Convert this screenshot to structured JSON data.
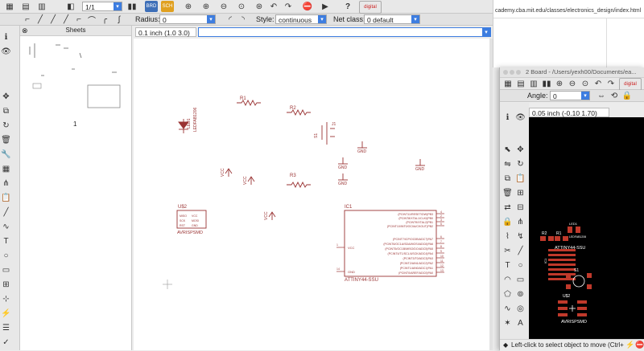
{
  "schematic": {
    "toolbar": {
      "sheet_selector": "1/1",
      "radius_label": "Radius:",
      "radius_value": "0",
      "style_label": "Style:",
      "style_value": "continuous",
      "netclass_label": "Net class:",
      "netclass_value": "0 default",
      "help_icon": "?"
    },
    "sheets_panel": {
      "title": "Sheets",
      "sheet_number": "1"
    },
    "coord_readout": "0.1 inch (1.0 3.0)",
    "command_input": "",
    "parts": {
      "r1": "R1",
      "r2": "R2",
      "r3": "R3",
      "led": "LED1",
      "led_value": "LEDFAB1206",
      "s1": "S1",
      "s1_ref": "J1",
      "vcc_labels": [
        "VCC",
        "VCC",
        "VCC"
      ],
      "gnd_labels": [
        "GND",
        "GND",
        "GND",
        "GND"
      ],
      "u2": "U$2",
      "u2_value": "AVRISPSMD",
      "u2_pins": [
        "MISO",
        "SCK",
        "RST",
        "VCC",
        "MOSI",
        "GND"
      ],
      "ic1": "IC1",
      "ic1_value": "ATTINY44-SSU",
      "ic1_vcc": "VCC",
      "ic1_gnd": "GND",
      "ic1_pin_names": [
        "(PCINT11/RESET/DW)PB3",
        "(PCINT8/XTAL1/CLKI)PB0",
        "(PCINT9/XTAL2)PB1",
        "(PCINT10/INT0/OC0A/CKOUT)PB2",
        "(PCINT7/ICP/OC0B/ADC7)PA7",
        "(PCINT6/OC1A/SDA/MOSI/ADC6)PA6",
        "(PCINT5/OC1B/MISO/DO/ADC5)PA5",
        "(PCINT4/T1/SCL/USCK/ADC4)PA4",
        "(PCINT3/T0/ADC3)PA3",
        "(PCINT2/AIN1/ADC2)PA2",
        "(PCINT1/AIN0/ADC1)PA1",
        "(PCINT0/AREF/ADC0)PA0"
      ],
      "ic1_pin_numbers": [
        "4",
        "2",
        "3",
        "5",
        "6",
        "7",
        "8",
        "9",
        "10",
        "11",
        "12",
        "13"
      ],
      "ic1_left_pins": [
        "1",
        "14"
      ]
    }
  },
  "browser_snippet": {
    "url": "cademy.cba.mit.edu/classes/electronics_design/index.html"
  },
  "board": {
    "title": "2 Board - /Users/yexh00/Documents/ea...",
    "angle_label": "Angle:",
    "angle_value": "0",
    "coord_readout": "0.05 inch (-0.10 1.70)",
    "status": "Left-click to select object to move (Ctrl+",
    "parts": {
      "r2": "R2",
      "r1": "R1",
      "led": "LED1",
      "led_value": "LEDFAB1206",
      "ic1": "IC1",
      "ic1_value": "ATTINY44-SSU",
      "s1": "S1",
      "u2": "U$2",
      "u2_value": "AVRISPSMD"
    }
  },
  "colors": {
    "schematic_part": "#9a3333",
    "pcb_pad": "#c0392b",
    "accent_blue": "#3d7de0",
    "pcb_background": "#000000"
  }
}
